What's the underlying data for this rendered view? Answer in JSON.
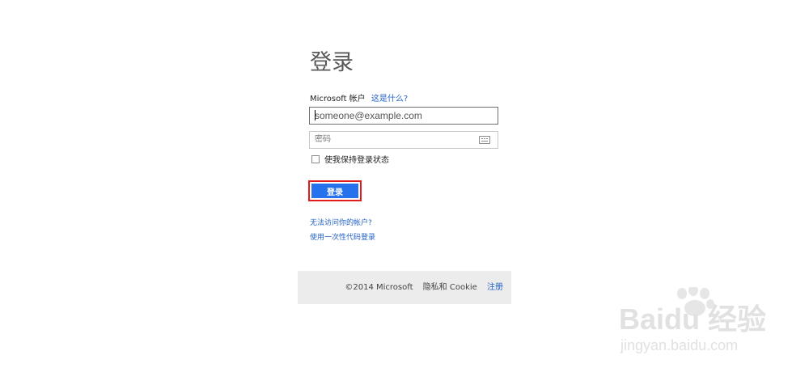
{
  "login": {
    "title": "登录",
    "account_label": "Microsoft 帐户",
    "whats_this_link": "这是什么?",
    "email_placeholder": "someone@example.com",
    "password_placeholder": "密码",
    "remember_label": "使我保持登录状态",
    "signin_button": "登录",
    "cant_access_link": "无法访问你的帐户?",
    "one_time_code_link": "使用一次性代码登录",
    "accent_color": "#2672ec",
    "highlight_color": "#e01c1c"
  },
  "footer": {
    "copyright": "©2014 Microsoft",
    "privacy": "隐私和 Cookie",
    "register": "注册"
  },
  "watermark": {
    "logo_text": "Baidu 经验",
    "url": "jingyan.baidu.com"
  }
}
